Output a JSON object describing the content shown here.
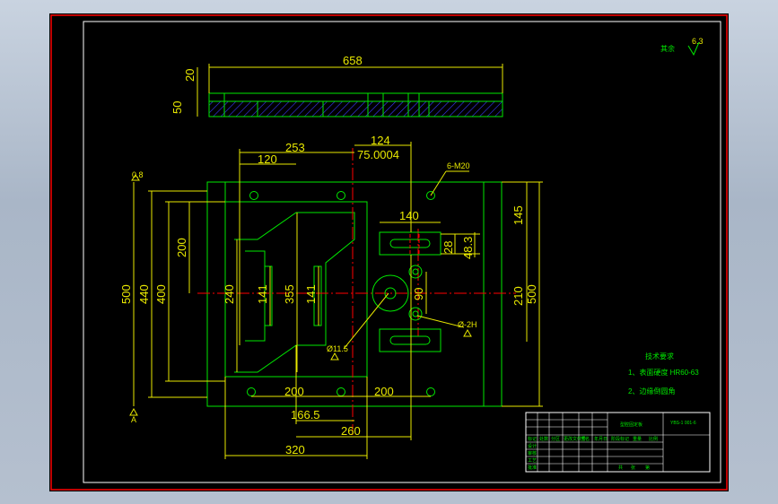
{
  "colors": {
    "frame": "#ff0000",
    "border": "#ffffff",
    "outline": "#00e800",
    "dimension": "#e8e800",
    "centerline": "#ff0000",
    "hatch": "#3b3bff"
  },
  "roughness_note": {
    "label": "其余",
    "value": "6.3"
  },
  "top_view": {
    "length": "658",
    "thickness_top": "20",
    "thickness_total": "50"
  },
  "plan_view": {
    "dims": {
      "d253": "253",
      "d124": "124",
      "d120": "120",
      "d_tol": "75.0004",
      "d140": "140",
      "d145": "145",
      "d28": "28",
      "d48": "48.3",
      "d500_left": "500",
      "d440": "440",
      "d400": "400",
      "d200_v": "200",
      "d240": "240",
      "d141_a": "141",
      "d355": "355",
      "d141_b": "141",
      "d90": "90",
      "d210": "210",
      "d500_right": "500",
      "d200_a": "200",
      "d200_b": "200",
      "d166": "166.5",
      "d260": "260",
      "d320": "320"
    },
    "labels": {
      "thread": "6-M20",
      "hole_dia": "Ø11.5",
      "hole_right": "Ø-2H",
      "datum_top": "0.8",
      "datum_bottom": "A"
    }
  },
  "tech_requirements": {
    "title": "技术要求",
    "items": [
      "1、表面硬度 HR60-63",
      "2、边缘倒圆角"
    ]
  },
  "title_block": {
    "part_name": "型腔固定板",
    "drawing_no": "YBS-1 001-6",
    "cells": [
      "标记",
      "处数",
      "分区",
      "更改文件号",
      "签名",
      "年月日",
      "设计",
      "审核",
      "工艺",
      "批准",
      "阶段标记",
      "重量",
      "比例",
      "共",
      "张",
      "第"
    ]
  }
}
